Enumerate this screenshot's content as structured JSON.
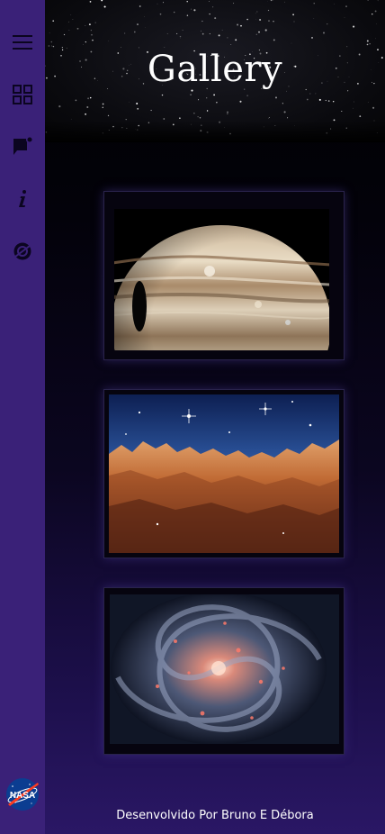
{
  "sidebar": {
    "items": [
      {
        "icon": "menu-icon"
      },
      {
        "icon": "grid-icon"
      },
      {
        "icon": "chat-notification-icon"
      },
      {
        "icon": "info-icon"
      },
      {
        "icon": "no-planet-icon"
      }
    ],
    "logo": {
      "text": "NASA"
    }
  },
  "header": {
    "title": "Gallery"
  },
  "gallery": {
    "images": [
      {
        "subject": "Jupiter"
      },
      {
        "subject": "Carina Nebula cliffs"
      },
      {
        "subject": "Spiral galaxy"
      }
    ]
  },
  "footer": {
    "credit": "Desenvolvido Por Bruno E Débora"
  },
  "colors": {
    "sidebar": "#3a2178",
    "background_bottom": "#2a1765",
    "text": "#ffffff"
  }
}
